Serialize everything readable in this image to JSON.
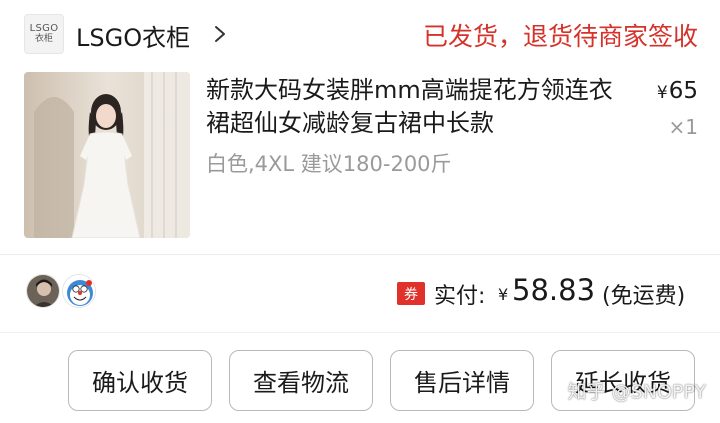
{
  "store": {
    "logo_text_line1": "LSGO",
    "logo_text_line2": "衣柜",
    "name": "LSGO衣柜",
    "icon": "chevron-right-icon"
  },
  "order": {
    "status": "已发货，退货待商家签收"
  },
  "product": {
    "title": "新款大码女装胖mm高端提花方领连衣裙超仙女减龄复古裙中长款",
    "spec": "白色,4XL 建议180-200斤",
    "price_currency": "¥",
    "price": "65",
    "quantity": "×1"
  },
  "payment": {
    "coupon_badge": "券",
    "label": "实付:",
    "currency": "¥",
    "amount": "58.83",
    "note": "(免运费)"
  },
  "actions": {
    "confirm_receipt": "确认收货",
    "view_logistics": "查看物流",
    "after_sales": "售后详情",
    "extend_receipt": "延长收货"
  },
  "watermark": "知乎 @SNOPPY",
  "colors": {
    "status_red": "#d4322a",
    "coupon_red": "#e0322a",
    "secondary_text": "#9a9a9a"
  }
}
